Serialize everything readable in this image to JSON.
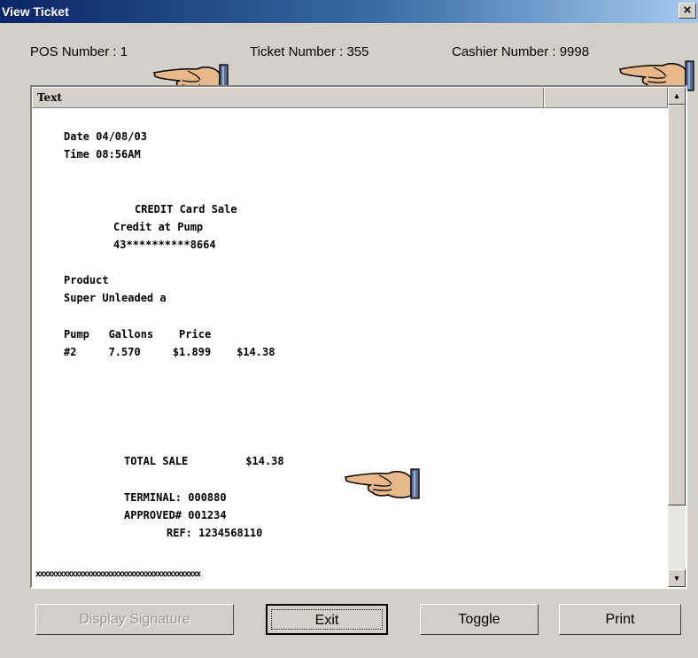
{
  "window": {
    "title": "View Ticket",
    "close_glyph": "×"
  },
  "header": {
    "pos_number": "POS Number : 1",
    "ticket_number": "Ticket Number : 355",
    "cashier_number": "Cashier Number : 9998"
  },
  "list": {
    "column_header": "Text"
  },
  "ticket_lines": [
    "Date 04/08/03",
    "Time 08:56AM",
    "CREDIT Card Sale",
    "Credit at Pump",
    "43**********8664",
    "Product",
    "Super Unleaded a",
    "Pump   Gallons    Price",
    "#2     7.570     $1.899    $14.38",
    "TOTAL SALE         $14.38",
    "TERMINAL: 000880",
    "APPROVED# 001234",
    "REF: 1234568110",
    "xxxxxxxxxxxxxxxxxxxxxxxxxxxxxxxxxxxxxxxxxx"
  ],
  "buttons": {
    "display_signature": "Display Signature",
    "exit": "Exit",
    "toggle": "Toggle",
    "print": "Print"
  },
  "scrollbar": {
    "up_glyph": "▲",
    "down_glyph": "▼"
  },
  "icons": [
    "pointing-hand-icon"
  ]
}
